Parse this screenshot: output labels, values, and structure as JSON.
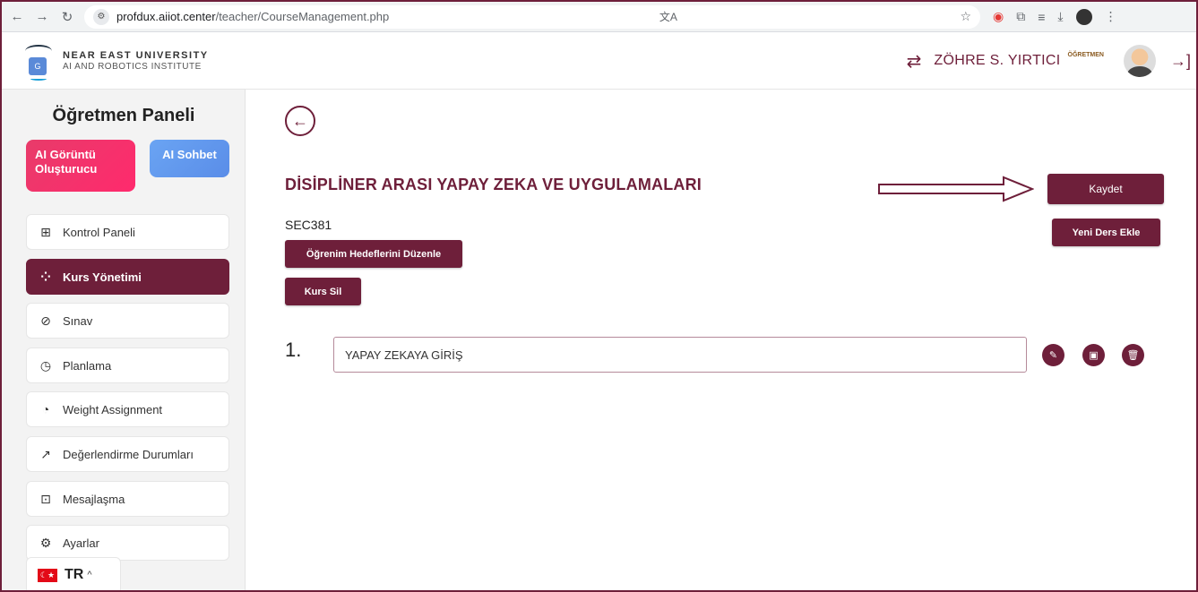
{
  "browser": {
    "url_host": "profdux.aiiot.center",
    "url_path": "/teacher/CourseManagement.php"
  },
  "header": {
    "logo_line1": "NEAR EAST UNIVERSITY",
    "logo_line2": "AI AND ROBOTICS INSTITUTE",
    "user_name": "ZÖHRE S. YIRTICI",
    "user_role": "ÖĞRETMEN"
  },
  "sidebar": {
    "title": "Öğretmen Paneli",
    "ai_image_label": "AI Görüntü Oluşturucu",
    "ai_chat_label": "AI Sohbet",
    "items": [
      {
        "label": "Kontrol Paneli",
        "icon": "grid-icon"
      },
      {
        "label": "Kurs Yönetimi",
        "icon": "apps-add-icon",
        "active": true
      },
      {
        "label": "Sınav",
        "icon": "compass-icon"
      },
      {
        "label": "Planlama",
        "icon": "clock-icon"
      },
      {
        "label": "Weight Assignment",
        "icon": "pie-chart-icon"
      },
      {
        "label": "Değerlendirme Durumları",
        "icon": "trend-chart-icon"
      },
      {
        "label": "Mesajlaşma",
        "icon": "message-box-icon"
      },
      {
        "label": "Ayarlar",
        "icon": "gear-icon"
      }
    ],
    "language": {
      "code": "TR",
      "flag": "turkey-flag-icon"
    }
  },
  "main": {
    "course_title": "DİSİPLİNER ARASI YAPAY ZEKA VE UYGULAMALARI",
    "course_code": "SEC381",
    "edit_goals_label": "Öğrenim Hedeflerini Düzenle",
    "delete_course_label": "Kurs Sil",
    "save_label": "Kaydet",
    "new_lesson_label": "Yeni Ders Ekle",
    "lessons": [
      {
        "number": "1.",
        "title": "YAPAY ZEKAYA GİRİŞ"
      }
    ]
  },
  "colors": {
    "accent": "#6e1f3a",
    "ai_image_card": "#ff2a6d",
    "ai_chat_card": "#5a8de8"
  }
}
